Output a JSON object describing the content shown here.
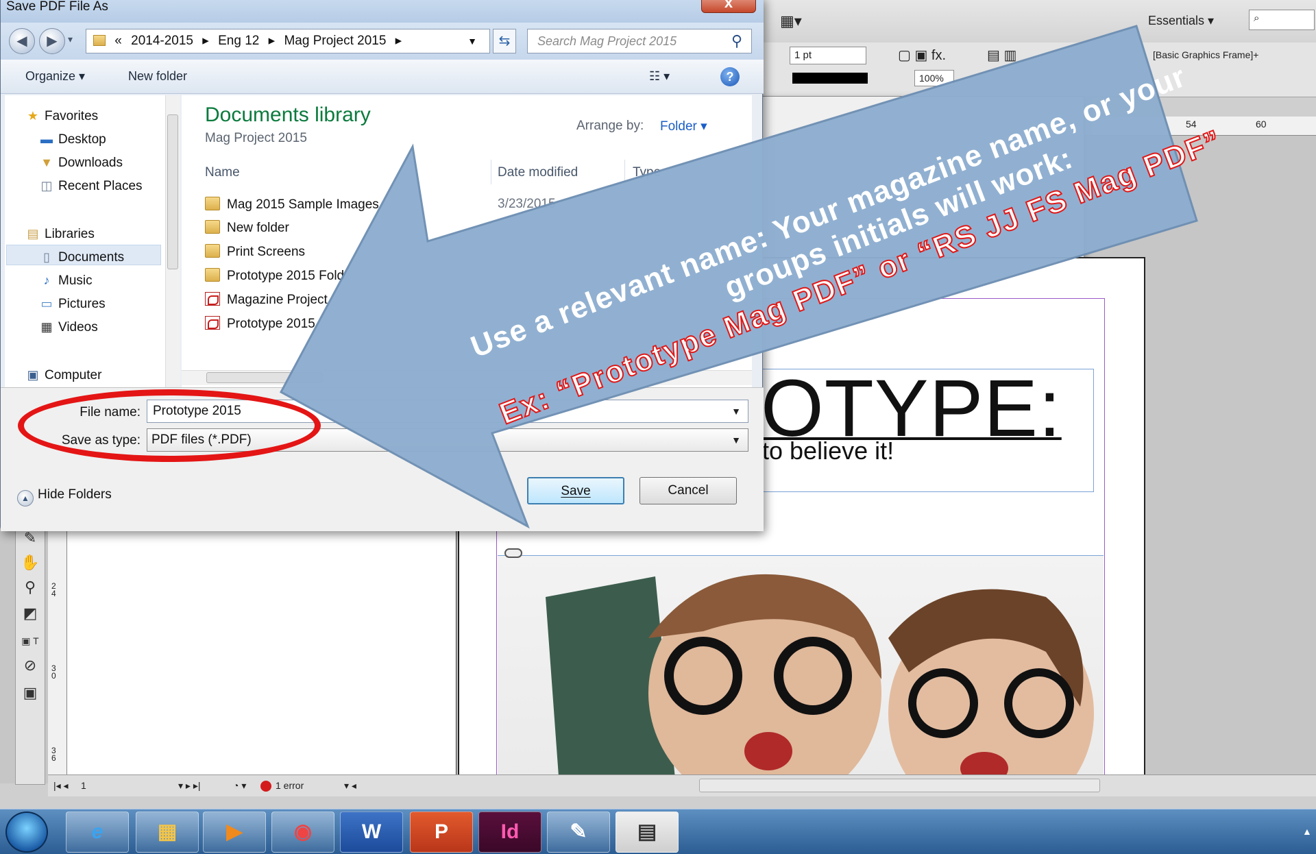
{
  "dialog": {
    "title": "Save PDF File As",
    "close_label": "x",
    "breadcrumb": [
      "«",
      "2014-2015",
      "▸",
      "Eng 12",
      "▸",
      "Mag Project 2015",
      "▸"
    ],
    "search_placeholder": "Search Mag Project 2015",
    "toolbar": {
      "organize": "Organize ▾",
      "new_folder": "New folder",
      "view": "☷ ▾",
      "help": "?"
    },
    "nav": {
      "favorites": "Favorites",
      "desktop": "Desktop",
      "downloads": "Downloads",
      "recent": "Recent Places",
      "libraries": "Libraries",
      "documents": "Documents",
      "music": "Music",
      "pictures": "Pictures",
      "videos": "Videos",
      "computer": "Computer"
    },
    "library_title": "Documents library",
    "library_sub": "Mag Project 2015",
    "arrange_label": "Arrange by:",
    "arrange_value": "Folder ▾",
    "columns": {
      "name": "Name",
      "date": "Date modified",
      "type": "Type"
    },
    "files": [
      {
        "name": "Mag 2015 Sample Images",
        "date": "3/23/2015"
      },
      {
        "name": "New folder",
        "date": ""
      },
      {
        "name": "Print Screens",
        "date": ""
      },
      {
        "name": "Prototype 2015 Fold",
        "date": ""
      },
      {
        "name": "Magazine Project",
        "date": ""
      },
      {
        "name": "Prototype 2015",
        "date": ""
      }
    ],
    "file_name_label": "File name:",
    "file_name_value": "Prototype 2015",
    "save_type_label": "Save as type:",
    "save_type_value": "PDF files (*.PDF)",
    "hide_folders": "Hide Folders",
    "save_button": "Save",
    "cancel_button": "Cancel"
  },
  "indesign": {
    "workspace": "Essentials ▾",
    "stroke_weight": "1 pt",
    "zoom": "100%",
    "frame_style": "[Basic Graphics Frame]+",
    "ruler_marks": [
      "24",
      "54",
      "60"
    ],
    "headline": "OTYPE:",
    "subline": "to believe it!",
    "page_number": "1",
    "status_error": "1 error"
  },
  "annotation": {
    "line1": "Use a relevant name: Your magazine name, or your",
    "line2": "groups initials will work:",
    "line3": "Ex: “Prototype Mag PDF” or “RS JJ FS Mag PDF”",
    "arrow_color": "#8eaed0",
    "oval_color": "#e41515",
    "example_color": "#e01919"
  },
  "taskbar": {
    "apps": [
      "start-orb",
      "internet-explorer",
      "file-explorer",
      "media-player",
      "chrome",
      "word",
      "powerpoint",
      "indesign",
      "paint",
      "notepad"
    ],
    "word_label": "W",
    "powerpoint_label": "P",
    "indesign_label": "Id"
  }
}
